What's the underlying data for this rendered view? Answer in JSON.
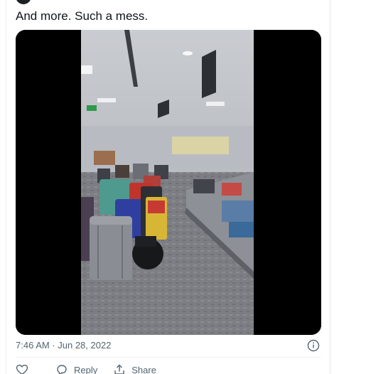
{
  "tweet": {
    "text": "And more. Such a mess.",
    "timestamp": "7:46 AM · Jun 28, 2022"
  },
  "media": {
    "type": "video",
    "description_icon": "airport-baggage-claim-video"
  },
  "actions": {
    "like_icon": "heart-icon",
    "reply_label": "Reply",
    "reply_icon": "reply-icon",
    "share_label": "Share",
    "share_icon": "share-icon"
  },
  "info_icon": "info-icon",
  "colors": {
    "text": "#0f1419",
    "secondary": "#536471",
    "divider": "#eff3f4"
  }
}
